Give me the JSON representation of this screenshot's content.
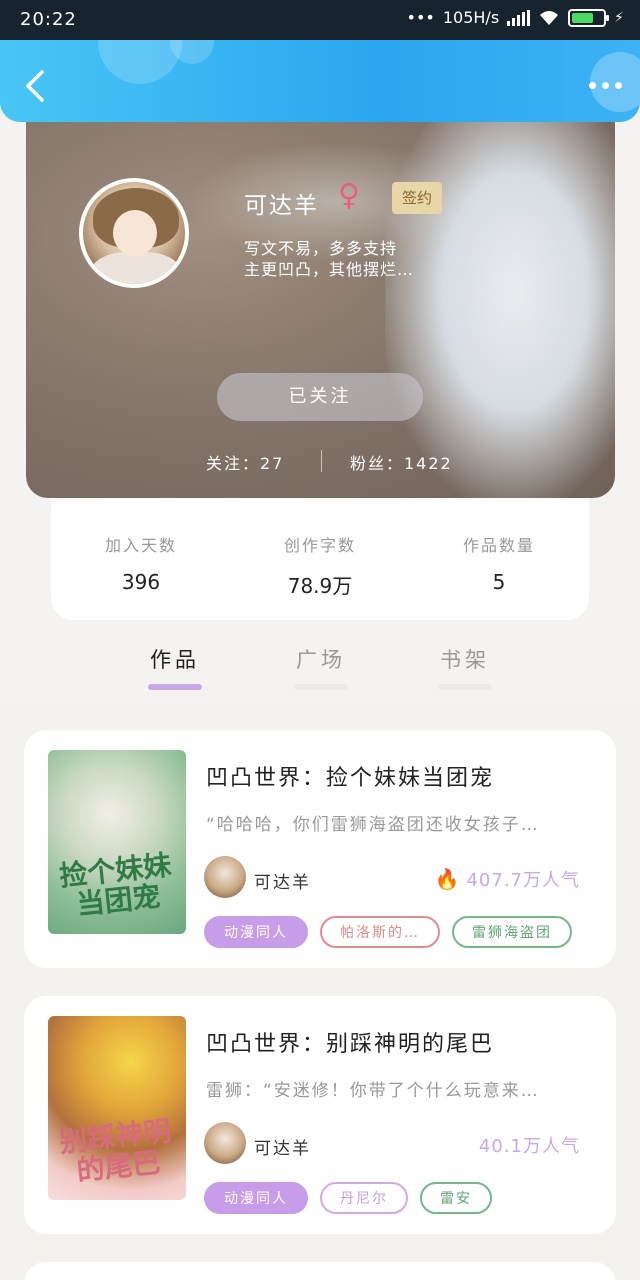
{
  "status_bar": {
    "time": "20:22",
    "network": "105H/s"
  },
  "profile": {
    "name": "可达羊",
    "gender_symbol": "♀",
    "badge": "签约",
    "bio_line1": "写文不易，多多支持",
    "bio_line2": "主更凹凸，其他摆烂…",
    "follow_button": "已关注",
    "following_label": "关注：27",
    "fans_label": "粉丝：1422"
  },
  "stats": [
    {
      "label": "加入天数",
      "value": "396"
    },
    {
      "label": "创作字数",
      "value": "78.9万"
    },
    {
      "label": "作品数量",
      "value": "5"
    }
  ],
  "tabs": [
    {
      "label": "作品",
      "active": true
    },
    {
      "label": "广场",
      "active": false
    },
    {
      "label": "书架",
      "active": false
    }
  ],
  "books": [
    {
      "title": "凹凸世界：捡个妹妹当团宠",
      "desc": "“哈哈哈，你们雷狮海盗团还收女孩子…",
      "author": "可达羊",
      "popularity": "407.7万人气",
      "cover_text": "捡个妹妹当团宠",
      "tags": [
        "动漫同人",
        "帕洛斯的…",
        "雷狮海盗团"
      ]
    },
    {
      "title": "凹凸世界：别踩神明的尾巴",
      "desc": "雷狮：“安迷修！你带了个什么玩意来…",
      "author": "可达羊",
      "popularity": "40.1万人气",
      "cover_text": "别踩神明的尾巴",
      "tags": [
        "动漫同人",
        "丹尼尔",
        "雷安"
      ]
    }
  ],
  "colors": {
    "accent": "#c79ce8",
    "header_blue": "#2aa6f0"
  }
}
